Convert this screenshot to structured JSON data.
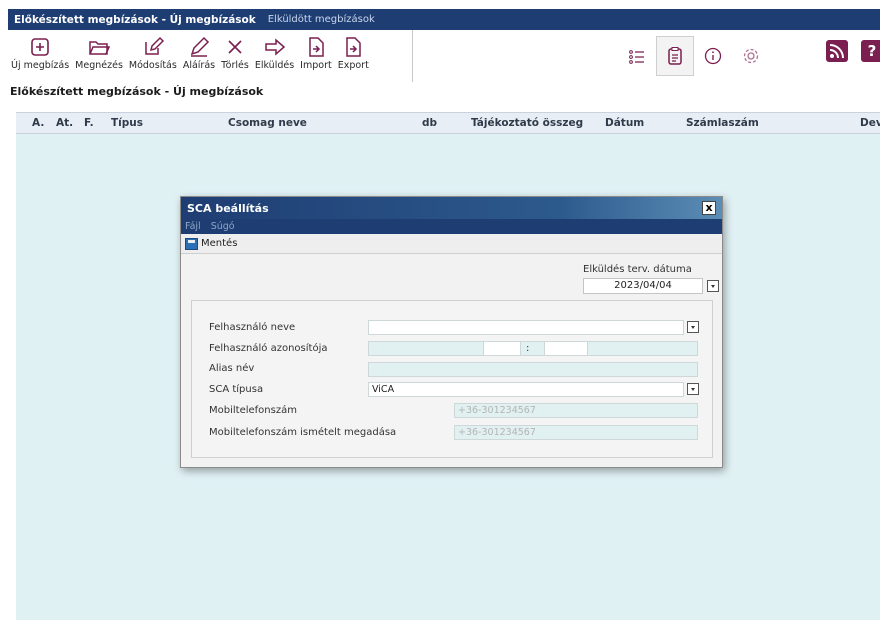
{
  "tabs": {
    "active": "Előkészített megbízások - Új megbízások",
    "inactive": "Elküldött megbízások"
  },
  "toolbar": {
    "new": "Új megbízás",
    "view": "Megnézés",
    "edit": "Módosítás",
    "sign": "Aláírás",
    "delete": "Törlés",
    "send": "Elküldés",
    "import": "Import",
    "export": "Export"
  },
  "right_tools": {
    "icons": [
      "list-icon",
      "clipboard-icon",
      "info-icon",
      "gear-icon"
    ],
    "help_label": "?"
  },
  "page_title": "Előkészített megbízások - Új megbízások",
  "grid": {
    "columns": [
      "A.",
      "At.",
      "F.",
      "Típus",
      "Csomag neve",
      "db",
      "Tájékoztató összeg",
      "Dátum",
      "Számlaszám",
      "Dev"
    ]
  },
  "dialog": {
    "title": "SCA beállítás",
    "close_label": "x",
    "menu": [
      "Fájl",
      "Súgó"
    ],
    "save_label": "Mentés",
    "send_date_label": "Elküldés terv. dátuma",
    "send_date_value": "2023/04/04",
    "fields": {
      "username_label": "Felhasználó neve",
      "username_value": "",
      "userid_label": "Felhasználó azonosítója",
      "userid_separator": ":",
      "alias_label": "Alias név",
      "alias_value": "",
      "sca_type_label": "SCA típusa",
      "sca_type_value": "ViCA",
      "mobile_label": "Mobiltelefonszám",
      "mobile_placeholder": "+36-301234567",
      "mobile_repeat_label": "Mobiltelefonszám ismételt megadása",
      "mobile_repeat_placeholder": "+36-301234567"
    }
  },
  "colors": {
    "nav_bg": "#1e3d73",
    "accent_icon": "#7a1f4f",
    "grid_body": "#e0f1f4"
  }
}
